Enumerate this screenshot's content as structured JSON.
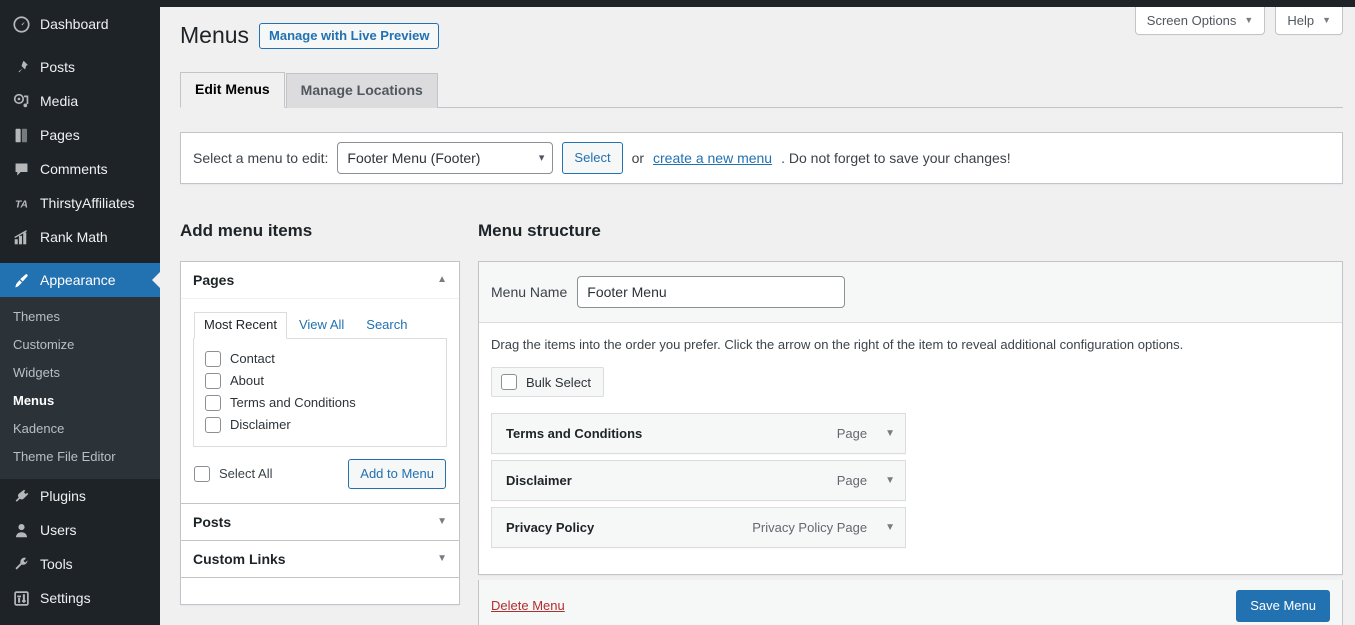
{
  "sidebar": {
    "items": [
      {
        "label": "Dashboard",
        "icon": "dashboard-icon",
        "current": false
      },
      {
        "label": "Posts",
        "icon": "pin-icon",
        "current": false,
        "gap": true
      },
      {
        "label": "Media",
        "icon": "media-icon",
        "current": false
      },
      {
        "label": "Pages",
        "icon": "pages-icon",
        "current": false
      },
      {
        "label": "Comments",
        "icon": "comments-icon",
        "current": false
      },
      {
        "label": "ThirstyAffiliates",
        "icon": "thirstyaffiliates-icon",
        "current": false
      },
      {
        "label": "Rank Math",
        "icon": "rankmath-icon",
        "current": false
      },
      {
        "label": "Appearance",
        "icon": "appearance-brush-icon",
        "current": true,
        "gap": true
      }
    ],
    "submenu": [
      {
        "label": "Themes",
        "current": false
      },
      {
        "label": "Customize",
        "current": false
      },
      {
        "label": "Widgets",
        "current": false
      },
      {
        "label": "Menus",
        "current": true
      },
      {
        "label": "Kadence",
        "current": false
      },
      {
        "label": "Theme File Editor",
        "current": false
      }
    ],
    "items_after": [
      {
        "label": "Plugins",
        "icon": "plugin-icon",
        "current": false
      },
      {
        "label": "Users",
        "icon": "users-icon",
        "current": false
      },
      {
        "label": "Tools",
        "icon": "tools-wrench-icon",
        "current": false
      },
      {
        "label": "Settings",
        "icon": "settings-icon",
        "current": false
      }
    ]
  },
  "screen_meta": {
    "screen_options": "Screen Options",
    "help": "Help",
    "caret": "▼"
  },
  "header": {
    "title": "Menus",
    "live_preview": "Manage with Live Preview"
  },
  "tabs": [
    {
      "label": "Edit Menus",
      "active": true
    },
    {
      "label": "Manage Locations",
      "active": false
    }
  ],
  "select_bar": {
    "label": "Select a menu to edit:",
    "selected": "Footer Menu (Footer)",
    "options": [
      "Footer Menu (Footer)"
    ],
    "select_button": "Select",
    "or_text": "or",
    "create_link": "create a new menu",
    "tail_text": ". Do not forget to save your changes!"
  },
  "add_menu_items": {
    "heading": "Add menu items",
    "panels": [
      {
        "title": "Pages",
        "expanded": true,
        "toggle_icon": "chevron-up-icon",
        "tabs": [
          {
            "label": "Most Recent",
            "active": true
          },
          {
            "label": "View All",
            "active": false
          },
          {
            "label": "Search",
            "active": false
          }
        ],
        "checkboxes": [
          {
            "label": "Contact",
            "checked": false
          },
          {
            "label": "About",
            "checked": false
          },
          {
            "label": "Terms and Conditions",
            "checked": false
          },
          {
            "label": "Disclaimer",
            "checked": false
          }
        ],
        "select_all": "Select All",
        "add_button": "Add to Menu"
      },
      {
        "title": "Posts",
        "expanded": false,
        "toggle_icon": "chevron-down-icon"
      },
      {
        "title": "Custom Links",
        "expanded": false,
        "toggle_icon": "chevron-down-icon"
      }
    ]
  },
  "menu_structure": {
    "heading": "Menu structure",
    "menu_name_label": "Menu Name",
    "menu_name_value": "Footer Menu",
    "drag_hint": "Drag the items into the order you prefer. Click the arrow on the right of the item to reveal additional configuration options.",
    "bulk_select": "Bulk Select",
    "items": [
      {
        "title": "Terms and Conditions",
        "type": "Page",
        "toggle_icon": "chevron-down-icon"
      },
      {
        "title": "Disclaimer",
        "type": "Page",
        "toggle_icon": "chevron-down-icon"
      },
      {
        "title": "Privacy Policy",
        "type": "Privacy Policy Page",
        "toggle_icon": "chevron-down-icon"
      }
    ]
  },
  "save_bar": {
    "delete_menu": "Delete Menu",
    "save_menu": "Save Menu"
  },
  "colors": {
    "sidebar_bg": "#1d2327",
    "submenu_bg": "#2c3338",
    "accent_blue": "#2271b1",
    "page_bg": "#f0f0f1",
    "delete_red": "#b32d2e"
  }
}
